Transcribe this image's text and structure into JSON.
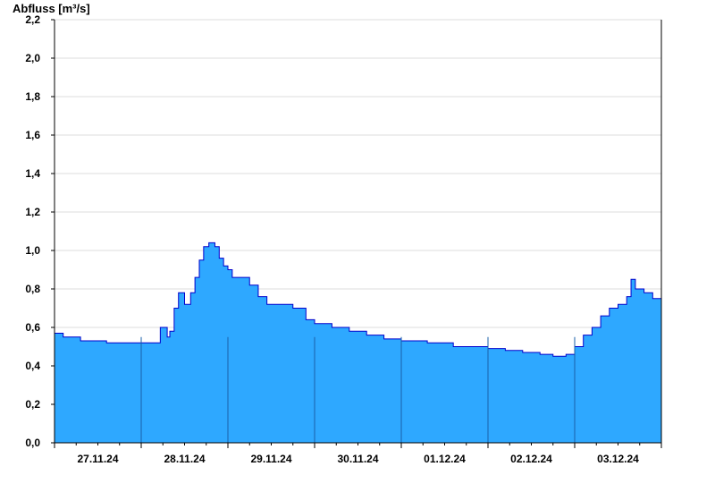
{
  "chart_data": {
    "type": "area",
    "ylabel": "Abfluss [m³/s]",
    "xlabel": "",
    "title": "",
    "ylim": [
      0,
      2.2
    ],
    "yticks": [
      0,
      0.2,
      0.4,
      0.6,
      0.8,
      1.0,
      1.2,
      1.4,
      1.6,
      1.8,
      2.0,
      2.2
    ],
    "ytick_labels": [
      "0,0",
      "0,2",
      "0,4",
      "0,6",
      "0,8",
      "1,0",
      "1,2",
      "1,4",
      "1,6",
      "1,8",
      "2,0",
      "2,2"
    ],
    "x_unit": "days",
    "xlim": [
      0,
      7
    ],
    "xtick_labels": [
      "27.11.24",
      "28.11.24",
      "29.11.24",
      "30.11.24",
      "01.12.24",
      "02.12.24",
      "03.12.24"
    ],
    "grid": true,
    "colors": {
      "fill": "#2ea8ff",
      "line": "#0000cc",
      "grid": "#dddddd",
      "axis": "#000000"
    },
    "x": [
      0,
      0.1,
      0.3,
      0.6,
      0.7,
      0.9,
      0.96,
      1.0,
      1.1,
      1.18,
      1.22,
      1.3,
      1.33,
      1.38,
      1.43,
      1.5,
      1.57,
      1.62,
      1.67,
      1.72,
      1.78,
      1.85,
      1.9,
      1.95,
      2.0,
      2.05,
      2.15,
      2.25,
      2.35,
      2.45,
      2.55,
      2.75,
      2.9,
      3.0,
      3.2,
      3.4,
      3.6,
      3.8,
      4.0,
      4.3,
      4.6,
      4.8,
      5.0,
      5.2,
      5.4,
      5.6,
      5.75,
      5.9,
      6.0,
      6.1,
      6.2,
      6.3,
      6.4,
      6.5,
      6.6,
      6.65,
      6.7,
      6.8,
      6.9,
      7.0
    ],
    "y": [
      0.57,
      0.55,
      0.53,
      0.52,
      0.52,
      0.52,
      0.52,
      0.52,
      0.52,
      0.52,
      0.6,
      0.55,
      0.58,
      0.7,
      0.78,
      0.72,
      0.78,
      0.86,
      0.95,
      1.02,
      1.04,
      1.02,
      0.96,
      0.92,
      0.9,
      0.86,
      0.86,
      0.82,
      0.76,
      0.72,
      0.72,
      0.7,
      0.64,
      0.62,
      0.6,
      0.58,
      0.56,
      0.54,
      0.53,
      0.52,
      0.5,
      0.5,
      0.49,
      0.48,
      0.47,
      0.46,
      0.45,
      0.46,
      0.5,
      0.56,
      0.6,
      0.66,
      0.7,
      0.72,
      0.76,
      0.85,
      0.8,
      0.78,
      0.75,
      0.7
    ]
  }
}
